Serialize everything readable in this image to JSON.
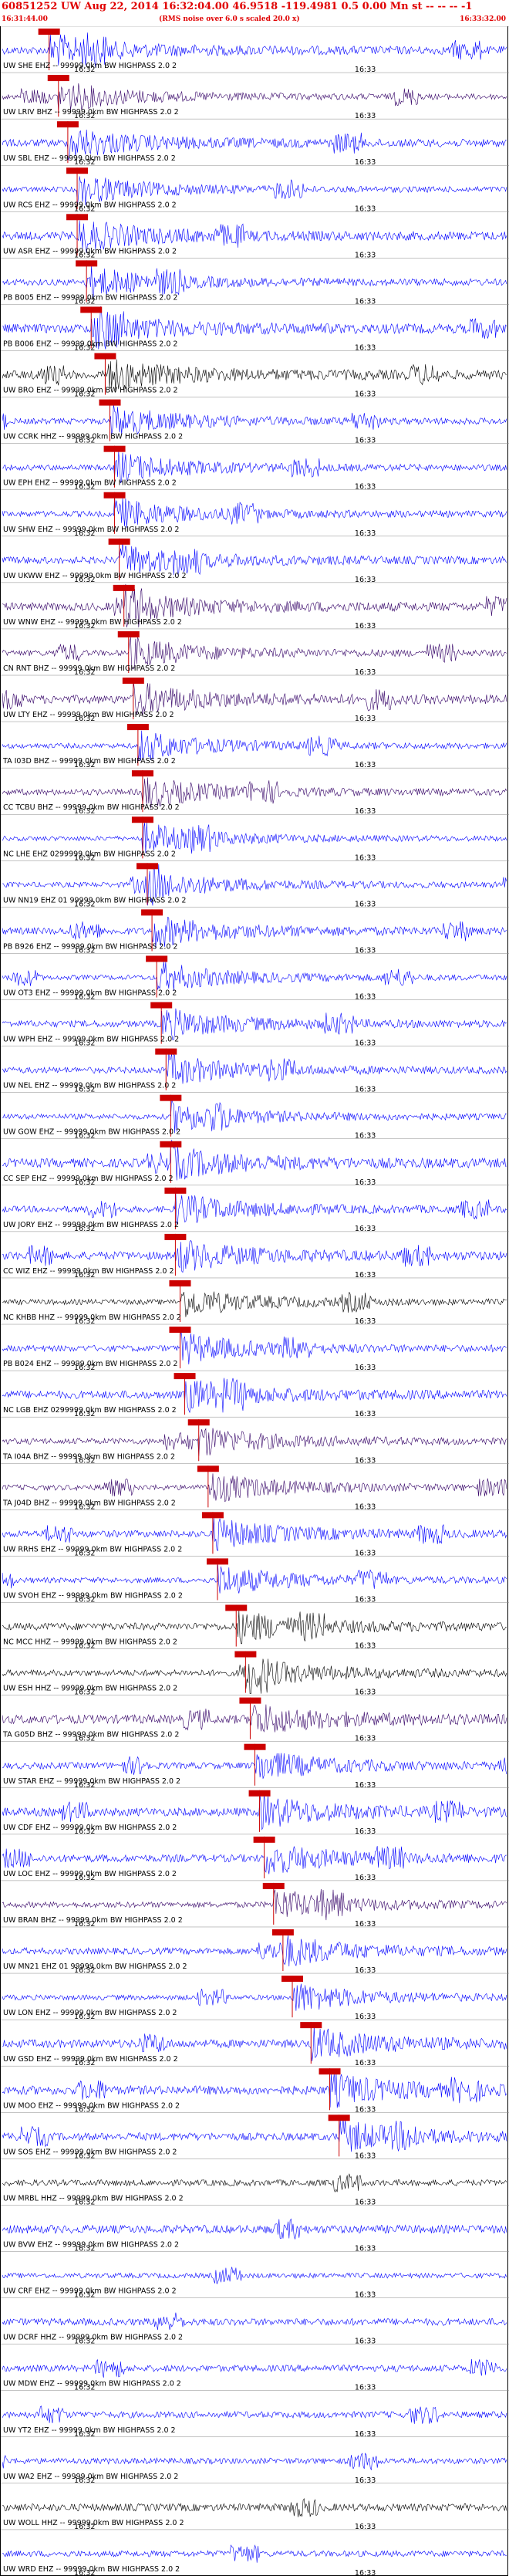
{
  "header": {
    "title": "60851252 UW Aug 22, 2014 16:32:04.00   46.9518 -119.4981  0.5 0.00 Mn st -- -- -- -1",
    "start_time": "16:31:44.00",
    "rms_note": "(RMS noise over 6.0 s scaled 20.0 x)",
    "end_time": "16:33:32.00"
  },
  "chart_data": {
    "type": "line",
    "title": "60851252 UW Aug 22, 2014 16:32:04.00   46.9518 -119.4981  0.5 0.00 Mn st -- -- -- -1",
    "time_range": [
      "16:31:44.00",
      "16:33:32.00"
    ],
    "tick_labels": [
      "16:32",
      "16:33"
    ],
    "colors": {
      "blue": "#0000ff",
      "purple": "#330066",
      "black": "#000000",
      "pick": "#cc0000",
      "title": "#e00000"
    },
    "traces": [
      {
        "label": "UW SHE EHZ -- 99999.0km BW  HIGHPASS  2.0  2",
        "color": "#0000ff",
        "pick": "16:31:54"
      },
      {
        "label": "UW LRIV BHZ -- 99999.0km BW  HIGHPASS  2.0  2",
        "color": "#330066",
        "pick": "16:31:56"
      },
      {
        "label": "UW SBL EHZ -- 99999.0km BW  HIGHPASS  2.0  2",
        "color": "#0000ff",
        "pick": "16:31:58"
      },
      {
        "label": "UW RCS EHZ -- 99999.0km BW  HIGHPASS  2.0  2",
        "color": "#0000ff",
        "pick": "16:32:00"
      },
      {
        "label": "UW ASR EHZ -- 99999.0km BW  HIGHPASS  2.0  2",
        "color": "#0000ff",
        "pick": "16:32:00"
      },
      {
        "label": "PB B005 EHZ -- 99999.0km BW  HIGHPASS  2.0  2",
        "color": "#0000ff",
        "pick": "16:32:02"
      },
      {
        "label": "PB B006 EHZ -- 99999.0km BW  HIGHPASS  2.0  2",
        "color": "#0000ff",
        "pick": "16:32:03"
      },
      {
        "label": "UW BRO EHZ -- 99999.0km BW  HIGHPASS  2.0  2",
        "color": "#000000",
        "pick": "16:32:06"
      },
      {
        "label": "UW CCRK HHZ -- 99999.0km BW  HIGHPASS  2.0  2",
        "color": "#0000ff",
        "pick": "16:32:07"
      },
      {
        "label": "UW EPH EHZ -- 99999.0km BW  HIGHPASS  2.0  2",
        "color": "#0000ff",
        "pick": "16:32:08"
      },
      {
        "label": "UW SHW EHZ -- 99999.0km BW  HIGHPASS  2.0  2",
        "color": "#0000ff",
        "pick": "16:32:08"
      },
      {
        "label": "UW UKWW EHZ -- 99999.0km BW  HIGHPASS  2.0  2",
        "color": "#0000ff",
        "pick": "16:32:09"
      },
      {
        "label": "UW WNW EHZ -- 99999.0km BW  HIGHPASS  2.0  2",
        "color": "#330066",
        "pick": "16:32:10"
      },
      {
        "label": "CN RNT BHZ -- 99999.0km BW  HIGHPASS  2.0  2",
        "color": "#330066",
        "pick": "16:32:11"
      },
      {
        "label": "UW LTY EHZ -- 99999.0km BW  HIGHPASS  2.0  2",
        "color": "#330066",
        "pick": "16:32:12"
      },
      {
        "label": "TA I03D BHZ -- 99999.0km BW  HIGHPASS  2.0  2",
        "color": "#0000ff",
        "pick": "16:32:13"
      },
      {
        "label": "CC TCBU BHZ -- 99999.0km BW  HIGHPASS  2.0  2",
        "color": "#330066",
        "pick": "16:32:14"
      },
      {
        "label": "NC LHE EHZ 0299999.0km BW  HIGHPASS  2.0  2",
        "color": "#0000ff",
        "pick": "16:32:14"
      },
      {
        "label": "UW NN19 EHZ 01 99999.0km BW  HIGHPASS  2.0  2",
        "color": "#0000ff",
        "pick": "16:32:15"
      },
      {
        "label": "PB B926 EHZ -- 99999.0km BW  HIGHPASS  2.0  2",
        "color": "#0000ff",
        "pick": "16:32:16"
      },
      {
        "label": "UW OT3 EHZ -- 99999.0km BW  HIGHPASS  2.0  2",
        "color": "#0000ff",
        "pick": "16:32:17"
      },
      {
        "label": "UW WPH EHZ -- 99999.0km BW  HIGHPASS  2.0  2",
        "color": "#0000ff",
        "pick": "16:32:18"
      },
      {
        "label": "UW NEL EHZ -- 99999.0km BW  HIGHPASS  2.0  2",
        "color": "#0000ff",
        "pick": "16:32:19"
      },
      {
        "label": "UW GOW EHZ -- 99999.0km BW  HIGHPASS  2.0  2",
        "color": "#0000ff",
        "pick": "16:32:20"
      },
      {
        "label": "CC SEP EHZ -- 99999.0km BW  HIGHPASS  2.0  2",
        "color": "#0000ff",
        "pick": "16:32:20"
      },
      {
        "label": "UW JORY EHZ -- 99999.0km BW  HIGHPASS  2.0  2",
        "color": "#0000ff",
        "pick": "16:32:21"
      },
      {
        "label": "CC WIZ EHZ -- 99999.0km BW  HIGHPASS  2.0  2",
        "color": "#0000ff",
        "pick": "16:32:21"
      },
      {
        "label": "NC KHBB HHZ -- 99999.0km BW  HIGHPASS  2.0  2",
        "color": "#000000",
        "pick": "16:32:22"
      },
      {
        "label": "PB B024 EHZ -- 99999.0km BW  HIGHPASS  2.0  2",
        "color": "#0000ff",
        "pick": "16:32:22"
      },
      {
        "label": "NC LGB EHZ 0299999.0km BW  HIGHPASS  2.0  2",
        "color": "#0000ff",
        "pick": "16:32:23"
      },
      {
        "label": "TA I04A BHZ -- 99999.0km BW  HIGHPASS  2.0  2",
        "color": "#330066",
        "pick": "16:32:26"
      },
      {
        "label": "TA J04D BHZ -- 99999.0km BW  HIGHPASS  2.0  2",
        "color": "#330066",
        "pick": "16:32:28"
      },
      {
        "label": "UW RRHS EHZ -- 99999.0km BW  HIGHPASS  2.0  2",
        "color": "#0000ff",
        "pick": "16:32:29"
      },
      {
        "label": "UW SVOH EHZ -- 99999.0km BW  HIGHPASS  2.0  2",
        "color": "#0000ff",
        "pick": "16:32:30"
      },
      {
        "label": "NC MCC HHZ -- 99999.0km BW  HIGHPASS  2.0  2",
        "color": "#000000",
        "pick": "16:32:34"
      },
      {
        "label": "UW ESH HHZ -- 99999.0km BW  HIGHPASS  2.0  2",
        "color": "#000000",
        "pick": "16:32:36"
      },
      {
        "label": "TA G05D BHZ -- 99999.0km BW  HIGHPASS  2.0  2",
        "color": "#330066",
        "pick": "16:32:37"
      },
      {
        "label": "UW STAR EHZ -- 99999.0km BW  HIGHPASS  2.0  2",
        "color": "#0000ff",
        "pick": "16:32:38"
      },
      {
        "label": "UW CDF EHZ -- 99999.0km BW  HIGHPASS  2.0  2",
        "color": "#0000ff",
        "pick": "16:32:39"
      },
      {
        "label": "UW LOC EHZ -- 99999.0km BW  HIGHPASS  2.0  2",
        "color": "#0000ff",
        "pick": "16:32:40"
      },
      {
        "label": "UW BRAN BHZ -- 99999.0km BW  HIGHPASS  2.0  2",
        "color": "#330066",
        "pick": "16:32:42"
      },
      {
        "label": "UW MN21 EHZ 01 99999.0km BW  HIGHPASS  2.0  2",
        "color": "#0000ff",
        "pick": "16:32:44"
      },
      {
        "label": "UW LON EHZ -- 99999.0km BW  HIGHPASS  2.0  2",
        "color": "#0000ff",
        "pick": "16:32:46"
      },
      {
        "label": "UW GSD EHZ -- 99999.0km BW  HIGHPASS  2.0  2",
        "color": "#0000ff",
        "pick": "16:32:50"
      },
      {
        "label": "UW MOO EHZ -- 99999.0km BW  HIGHPASS  2.0  2",
        "color": "#0000ff",
        "pick": "16:32:54"
      },
      {
        "label": "UW SOS EHZ -- 99999.0km BW  HIGHPASS  2.0  2",
        "color": "#0000ff",
        "pick": "16:32:56"
      },
      {
        "label": "UW MRBL HHZ -- 99999.0km BW  HIGHPASS  2.0  2",
        "color": "#000000",
        "pick": ""
      },
      {
        "label": "UW BVW EHZ -- 99999.0km BW  HIGHPASS  2.0  2",
        "color": "#0000ff",
        "pick": ""
      },
      {
        "label": "UW CRF EHZ -- 99999.0km BW  HIGHPASS  2.0  2",
        "color": "#0000ff",
        "pick": ""
      },
      {
        "label": "UW DCRF HHZ -- 99999.0km BW  HIGHPASS  2.0  2",
        "color": "#0000ff",
        "pick": ""
      },
      {
        "label": "UW MDW EHZ -- 99999.0km BW  HIGHPASS  2.0  2",
        "color": "#0000ff",
        "pick": ""
      },
      {
        "label": "UW YT2 EHZ -- 99999.0km BW  HIGHPASS  2.0  2",
        "color": "#0000ff",
        "pick": ""
      },
      {
        "label": "UW WA2 EHZ -- 99999.0km BW  HIGHPASS  2.0  2",
        "color": "#0000ff",
        "pick": ""
      },
      {
        "label": "UW WOLL HHZ -- 99999.0km BW  HIGHPASS  2.0  2",
        "color": "#000000",
        "pick": ""
      },
      {
        "label": "UW WRD EHZ -- 99999.0km BW  HIGHPASS  2.0  2",
        "color": "#0000ff",
        "pick": ""
      }
    ]
  }
}
